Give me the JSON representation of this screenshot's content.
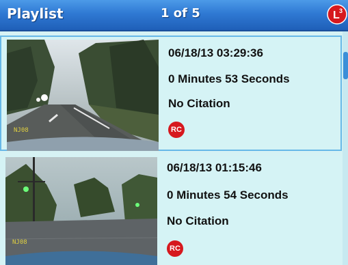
{
  "header": {
    "title": "Playlist",
    "page_indicator": "1 of 5",
    "logo_icon": "l3-logo-icon"
  },
  "playlist": [
    {
      "datetime": "06/18/13  03:29:36",
      "duration": "0 Minutes 53 Seconds",
      "citation": "No Citation",
      "badge": "RC",
      "camera_label": "NJ08",
      "selected": true
    },
    {
      "datetime": "06/18/13  01:15:46",
      "duration": "0 Minutes 54 Seconds",
      "citation": "No Citation",
      "badge": "RC",
      "camera_label": "NJ08",
      "selected": false
    }
  ],
  "colors": {
    "header": "#2f79d3",
    "list_background": "#d5f3f5",
    "selection_border": "#67b8e8",
    "badge": "#d6181e"
  }
}
